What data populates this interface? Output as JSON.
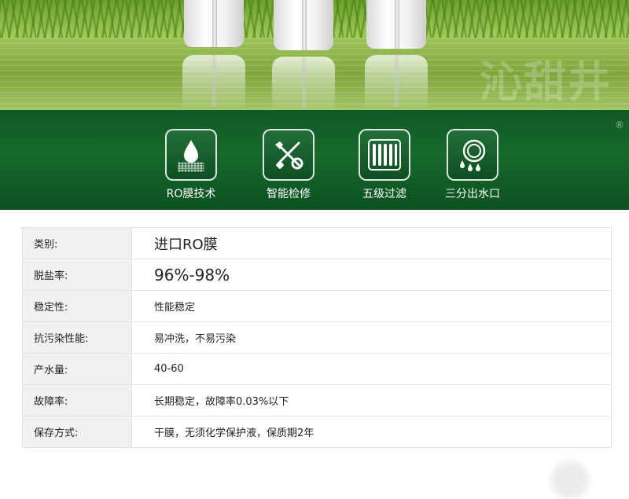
{
  "hero": {
    "watermark": "沁甜井",
    "registered_mark": "®"
  },
  "features": [
    {
      "icon": "droplet-membrane-icon",
      "label": "RO膜技术"
    },
    {
      "icon": "wrench-screwdriver-icon",
      "label": "智能检修"
    },
    {
      "icon": "five-stage-filter-icon",
      "label": "五级过滤"
    },
    {
      "icon": "water-outlet-icon",
      "label": "三分出水口"
    }
  ],
  "specs": [
    {
      "key": "类别:",
      "value": "进口RO膜"
    },
    {
      "key": "脱盐率:",
      "value": "96%-98%"
    },
    {
      "key": "稳定性:",
      "value": "性能稳定"
    },
    {
      "key": "抗污染性能:",
      "value": "易冲洗，不易污染"
    },
    {
      "key": "产水量:",
      "value": "40-60"
    },
    {
      "key": "故障率:",
      "value": "长期稳定，故障率0.03%以下"
    },
    {
      "key": "保存方式:",
      "value": "干膜，无须化学保护液，保质期2年"
    }
  ],
  "colors": {
    "band_green": "#16692d",
    "tile_border": "#ffffff",
    "key_bg": "#f1f1f1",
    "table_border": "#e3e3e3"
  }
}
